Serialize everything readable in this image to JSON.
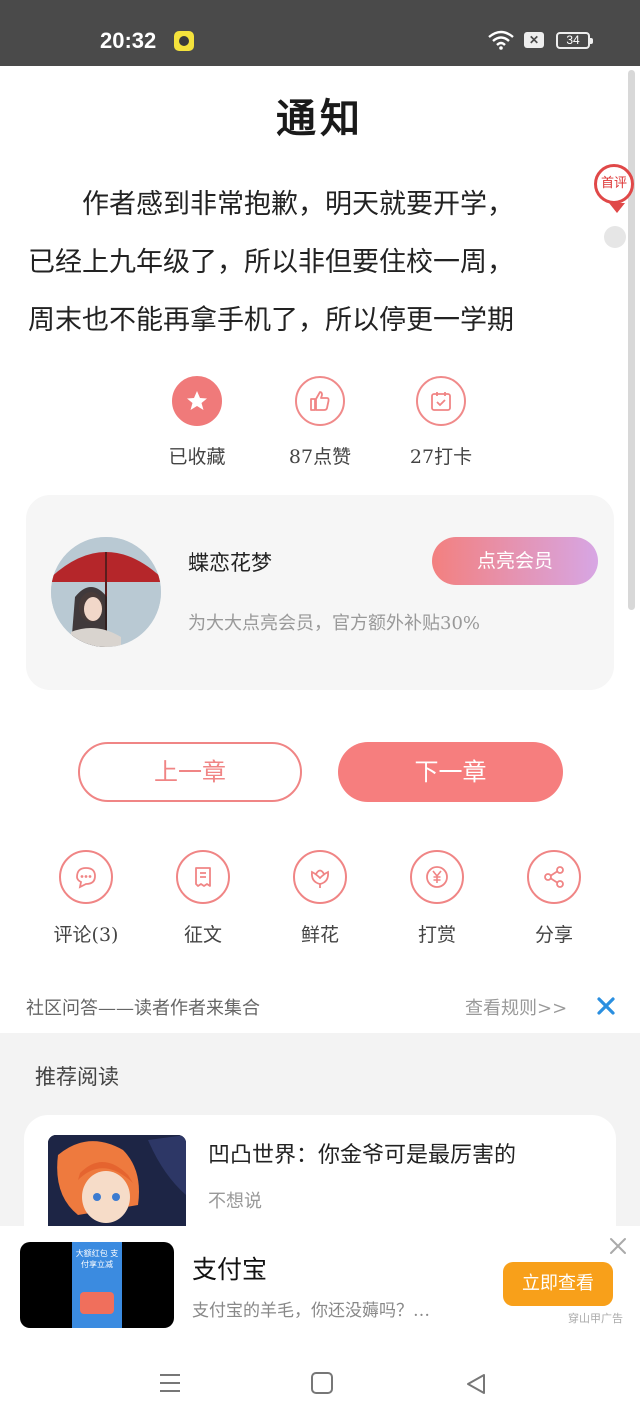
{
  "status_bar": {
    "time": "20:32",
    "battery": "34"
  },
  "chapter": {
    "title": "通知",
    "paragraphs": [
      "　　作者感到非常抱歉，明天就要开学，",
      "已经上九年级了，所以非但要住校一周，",
      "周末也不能再拿手机了，所以停更一学期"
    ]
  },
  "first_comment_badge": "首评",
  "actions": [
    {
      "label": "已收藏",
      "icon": "star-icon"
    },
    {
      "label": "87点赞",
      "icon": "thumbs-up-icon"
    },
    {
      "label": "27打卡",
      "icon": "calendar-check-icon"
    }
  ],
  "author": {
    "name": "蝶恋花梦",
    "member_button": "点亮会员",
    "description": "为大大点亮会员，官方额外补贴30%"
  },
  "chapter_nav": {
    "prev": "上一章",
    "next": "下一章"
  },
  "tools": [
    {
      "label": "评论(3)",
      "icon": "comment-icon"
    },
    {
      "label": "征文",
      "icon": "document-icon"
    },
    {
      "label": "鲜花",
      "icon": "flower-icon"
    },
    {
      "label": "打赏",
      "icon": "yen-coin-icon"
    },
    {
      "label": "分享",
      "icon": "share-icon"
    }
  ],
  "community": {
    "text": "社区问答——读者作者来集合",
    "rules_link": "查看规则>>"
  },
  "recommended": {
    "section_title": "推荐阅读",
    "book": {
      "title": "凹凸世界：你金爷可是最厉害的",
      "subtitle": "不想说"
    }
  },
  "ad": {
    "title": "支付宝",
    "description": "支付宝的羊毛，你还没薅吗？…",
    "button": "立即查看",
    "tag": "穿山甲广告",
    "thumb_text": "大额红包 支付享立减"
  },
  "colors": {
    "accent": "#f67e7e",
    "ad_button": "#f8a01a",
    "status_bar": "#4a4a4a"
  }
}
